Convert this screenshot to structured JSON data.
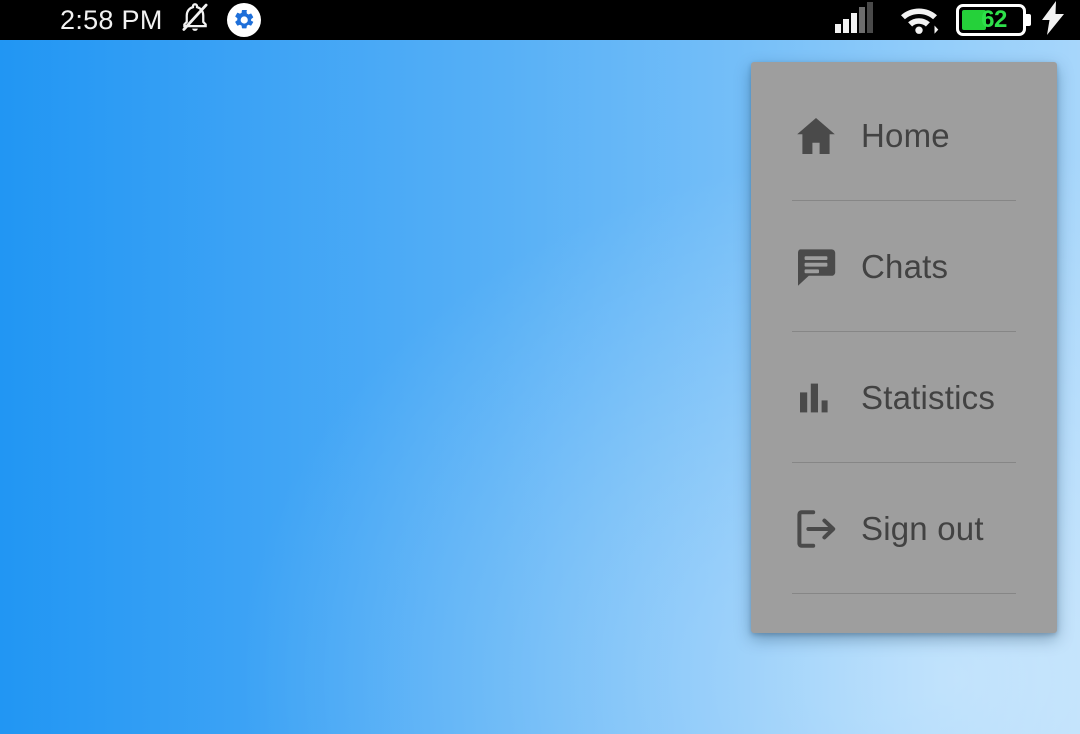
{
  "status_bar": {
    "clock": "2:58 PM",
    "notifications_muted_icon": "bell-off-icon",
    "settings_icon": "gear-icon",
    "signal_icon": "cellular-signal-icon",
    "signal_bars_total": 5,
    "signal_bars_active": 3,
    "wifi_icon": "wifi-icon",
    "battery": {
      "level": "62",
      "charging": true,
      "charging_icon": "lightning-bolt-icon",
      "fill_color": "#25d13a",
      "text_color": "#2ee04a"
    }
  },
  "wallpaper": {
    "gradient_start": "#2196f3",
    "gradient_end": "#a7d6fb"
  },
  "drawer": {
    "background_color": "#9e9e9e",
    "text_color": "#424242",
    "items": [
      {
        "label": "Home",
        "icon": "home-icon"
      },
      {
        "label": "Chats",
        "icon": "chat-bubble-icon"
      },
      {
        "label": "Statistics",
        "icon": "bar-chart-icon"
      },
      {
        "label": "Sign out",
        "icon": "sign-out-icon"
      }
    ]
  }
}
